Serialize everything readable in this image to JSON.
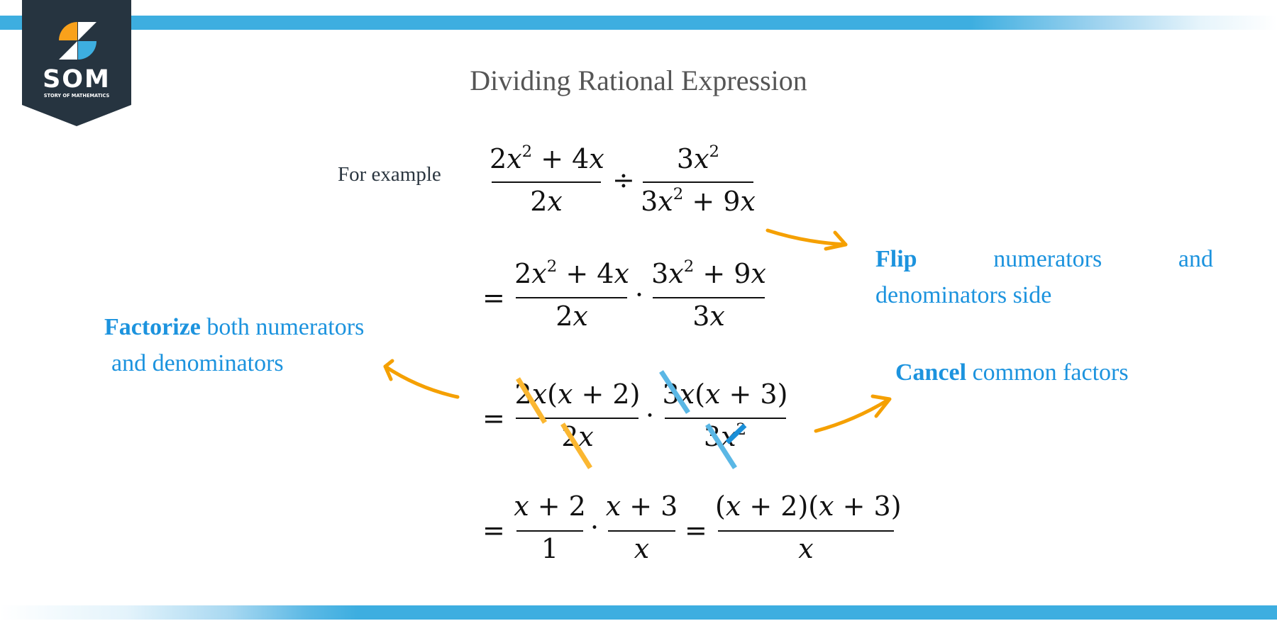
{
  "brand": {
    "logo_text": "SOM",
    "logo_tagline": "STORY OF MATHEMATICS",
    "logo_icon": "som-s-icon",
    "colors": {
      "badge": "#263440",
      "orange": "#f9a11b",
      "blue": "#3daee0",
      "accent_text": "#1c93de",
      "arrow": "#f5a000",
      "strike_orange": "#fbb731",
      "strike_blue": "#5ab7e5",
      "strike_dark_blue": "#1a8fd8"
    }
  },
  "title": "Dividing Rational Expression",
  "example_label": "For example",
  "steps": [
    {
      "name": "problem",
      "lead_op": "",
      "terms": [
        {
          "num": "2x² + 4x",
          "den": "2x"
        },
        {
          "op": "÷"
        },
        {
          "num": "3x²",
          "den": "3x² + 9x"
        }
      ]
    },
    {
      "name": "flip",
      "lead_op": "=",
      "terms": [
        {
          "num": "2x² + 4x",
          "den": "2x"
        },
        {
          "op": "·"
        },
        {
          "num": "3x² + 9x",
          "den": "3x"
        }
      ]
    },
    {
      "name": "factorize",
      "lead_op": "=",
      "terms": [
        {
          "num": "2x(x + 2)",
          "den": "2x"
        },
        {
          "op": "·"
        },
        {
          "num": "3x(x + 3)",
          "den": "3x²"
        }
      ],
      "cancelled": [
        "2x (numerator 1)",
        "2x (denominator 1)",
        "3x (numerator 2)",
        "3x (denominator 2)"
      ]
    },
    {
      "name": "result",
      "lead_op": "=",
      "terms": [
        {
          "num": "x + 2",
          "den": "1"
        },
        {
          "op": "·"
        },
        {
          "num": "x + 3",
          "den": "x"
        },
        {
          "op": "="
        },
        {
          "num": "(x + 2)(x + 3)",
          "den": "x"
        }
      ]
    }
  ],
  "notes": {
    "flip": {
      "bold": "Flip",
      "word2": "numerators",
      "word3": "and",
      "line2": "denominators side"
    },
    "factorize": {
      "bold": "Factorize",
      "rest": " both numerators",
      "line2": "and denominators"
    },
    "cancel": {
      "bold": "Cancel",
      "rest": " common factors"
    }
  }
}
